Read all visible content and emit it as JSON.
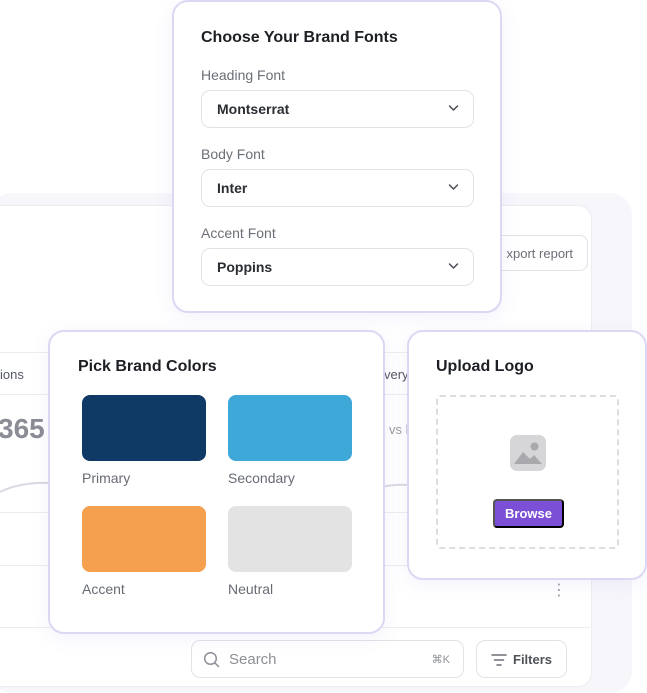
{
  "dashboard": {
    "export_label": "xport report",
    "col_left_fragment": "ions",
    "col_right_fragment": "very",
    "big_value_fragment": "365",
    "compare_fragment": "vs l",
    "search_placeholder": "Search",
    "search_shortcut": "⌘K",
    "filters_label": "Filters"
  },
  "fonts_card": {
    "title": "Choose Your Brand Fonts",
    "fields": [
      {
        "label": "Heading Font",
        "value": "Montserrat"
      },
      {
        "label": "Body Font",
        "value": "Inter"
      },
      {
        "label": "Accent Font",
        "value": "Poppins"
      }
    ]
  },
  "colors_card": {
    "title": "Pick Brand Colors",
    "swatches": [
      {
        "label": "Primary",
        "color": "#0f3a66"
      },
      {
        "label": "Secondary",
        "color": "#3ea9d9"
      },
      {
        "label": "Accent",
        "color": "#f4a04e"
      },
      {
        "label": "Neutral",
        "color": "#e3e3e3"
      }
    ]
  },
  "logo_card": {
    "title": "Upload Logo",
    "browse_label": "Browse",
    "accent_color": "#7b4fd6"
  },
  "icons": [
    "chevron-down-icon",
    "image-icon",
    "search-icon",
    "filter-icon",
    "kebab-menu-icon"
  ]
}
